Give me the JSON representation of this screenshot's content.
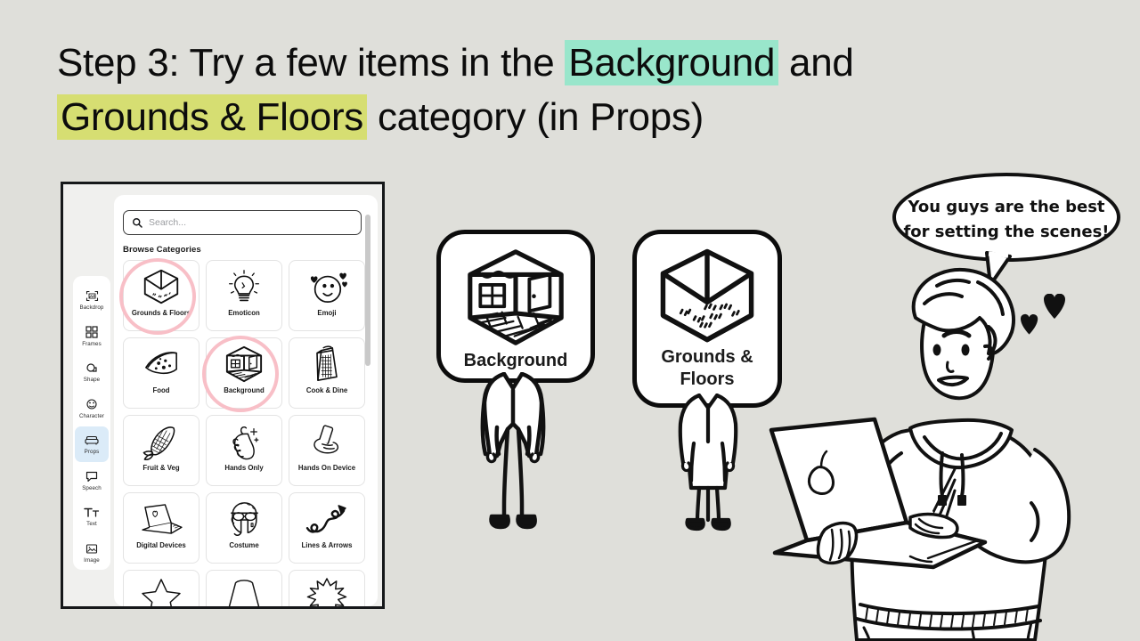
{
  "page": {
    "background_color": "#dfdfda",
    "title_lines": [
      {
        "segments": [
          {
            "text": "Step 3: Try a few items in the ",
            "highlight": "none"
          },
          {
            "text": "Background",
            "highlight": "teal"
          },
          {
            "text": " and",
            "highlight": "none"
          }
        ]
      },
      {
        "segments": [
          {
            "text": "Grounds & Floors",
            "highlight": "lime"
          },
          {
            "text": " category (in Props)",
            "highlight": "none"
          }
        ]
      }
    ],
    "title_plain": "Step 3: Try a few items in the Background and Grounds & Floors category (in Props)",
    "highlight_colors": {
      "teal": "#99e6cb",
      "lime": "#d6de72"
    },
    "annotation_ring_color": "#f8bfc7"
  },
  "app_panel": {
    "sidebar": {
      "selected": "Props",
      "selected_bg": "#dbebf8",
      "items": [
        {
          "label": "Backdrop",
          "icon": "backdrop-icon"
        },
        {
          "label": "Frames",
          "icon": "frames-icon"
        },
        {
          "label": "Shape",
          "icon": "shape-icon"
        },
        {
          "label": "Character",
          "icon": "character-icon"
        },
        {
          "label": "Props",
          "icon": "props-icon"
        },
        {
          "label": "Speech",
          "icon": "speech-icon"
        },
        {
          "label": "Text",
          "icon": "text-icon"
        },
        {
          "label": "Image",
          "icon": "image-icon"
        }
      ]
    },
    "search": {
      "placeholder": "Search...",
      "value": "",
      "icon": "search-icon"
    },
    "browse_heading": "Browse Categories",
    "categories": [
      {
        "label": "Grounds & Floors",
        "icon": "room-corner-icon",
        "annotated": true
      },
      {
        "label": "Emoticon",
        "icon": "lightbulb-icon",
        "annotated": false
      },
      {
        "label": "Emoji",
        "icon": "smiley-hearts-icon",
        "annotated": false
      },
      {
        "label": "Food",
        "icon": "pizza-slice-icon",
        "annotated": false
      },
      {
        "label": "Background",
        "icon": "room-window-door-icon",
        "annotated": true
      },
      {
        "label": "Cook & Dine",
        "icon": "grater-icon",
        "annotated": false
      },
      {
        "label": "Fruit & Veg",
        "icon": "corn-icon",
        "annotated": false
      },
      {
        "label": "Hands Only",
        "icon": "pinch-hand-icon",
        "annotated": false
      },
      {
        "label": "Hands On Device",
        "icon": "hand-phone-icon",
        "annotated": false
      },
      {
        "label": "Digital Devices",
        "icon": "laptop-icon",
        "annotated": false
      },
      {
        "label": "Costume",
        "icon": "aviator-cap-icon",
        "annotated": false
      },
      {
        "label": "Lines & Arrows",
        "icon": "curly-arrow-icon",
        "annotated": false
      },
      {
        "label": "",
        "icon": "star-icon",
        "annotated": false
      },
      {
        "label": "",
        "icon": "lampshade-icon",
        "annotated": false
      },
      {
        "label": "",
        "icon": "starburst-icon",
        "annotated": false
      }
    ]
  },
  "cards": [
    {
      "caption": "Background",
      "icon": "room-window-door-icon"
    },
    {
      "caption": "Grounds & Floors",
      "icon": "room-corner-icon"
    }
  ],
  "speech_bubble": {
    "lines": [
      "You guys are the best",
      "for setting the scenes!"
    ],
    "text": "You guys are the best for setting the scenes!"
  },
  "figures": [
    {
      "name": "figure-with-background-head",
      "description": "standing person whose head is the Background card"
    },
    {
      "name": "figure-with-grounds-head",
      "description": "standing person whose head is the Grounds & Floors card"
    },
    {
      "name": "person-with-laptop",
      "description": "smiling person in hoodie holding an open laptop with pear logo"
    }
  ],
  "decorations": {
    "hearts_count": 2,
    "hearts_color": "#111111"
  }
}
